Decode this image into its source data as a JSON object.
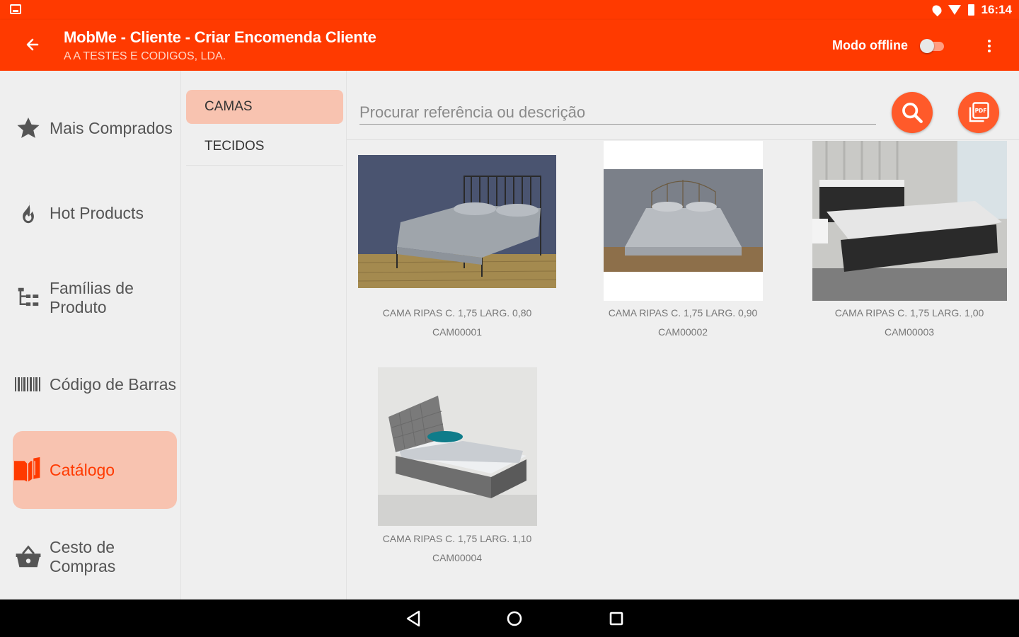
{
  "status_bar": {
    "time": "16:14"
  },
  "app_bar": {
    "title": "MobMe - Cliente - Criar Encomenda Cliente",
    "subtitle": "A A TESTES E CODIGOS, LDA.",
    "offline_label": "Modo offline",
    "offline_enabled": false
  },
  "sidebar": {
    "items": [
      {
        "label": "Mais Comprados",
        "icon": "star-icon",
        "active": false
      },
      {
        "label": "Hot Products",
        "icon": "flame-icon",
        "active": false
      },
      {
        "label": "Famílias de Produto",
        "icon": "tree-icon",
        "active": false
      },
      {
        "label": "Código de Barras",
        "icon": "barcode-icon",
        "active": false
      },
      {
        "label": "Catálogo",
        "icon": "catalog-book-icon",
        "active": true
      },
      {
        "label": "Cesto de Compras",
        "icon": "basket-icon",
        "active": false
      }
    ]
  },
  "categories": {
    "items": [
      {
        "label": "CAMAS",
        "active": true
      },
      {
        "label": "TECIDOS",
        "active": false
      }
    ]
  },
  "search": {
    "placeholder": "Procurar referência ou descrição",
    "value": ""
  },
  "products": [
    {
      "description": "CAMA RIPAS C. 1,75 LARG. 0,80",
      "code": "CAM00001"
    },
    {
      "description": "CAMA RIPAS C. 1,75 LARG. 0,90",
      "code": "CAM00002"
    },
    {
      "description": "CAMA RIPAS C. 1,75 LARG. 1,00",
      "code": "CAM00003"
    },
    {
      "description": "CAMA RIPAS C. 1,75 LARG. 1,10",
      "code": "CAM00004"
    }
  ],
  "colors": {
    "primary": "#ff3a00",
    "active_bg": "#f8c3b0",
    "fab": "#ff5a2a"
  }
}
